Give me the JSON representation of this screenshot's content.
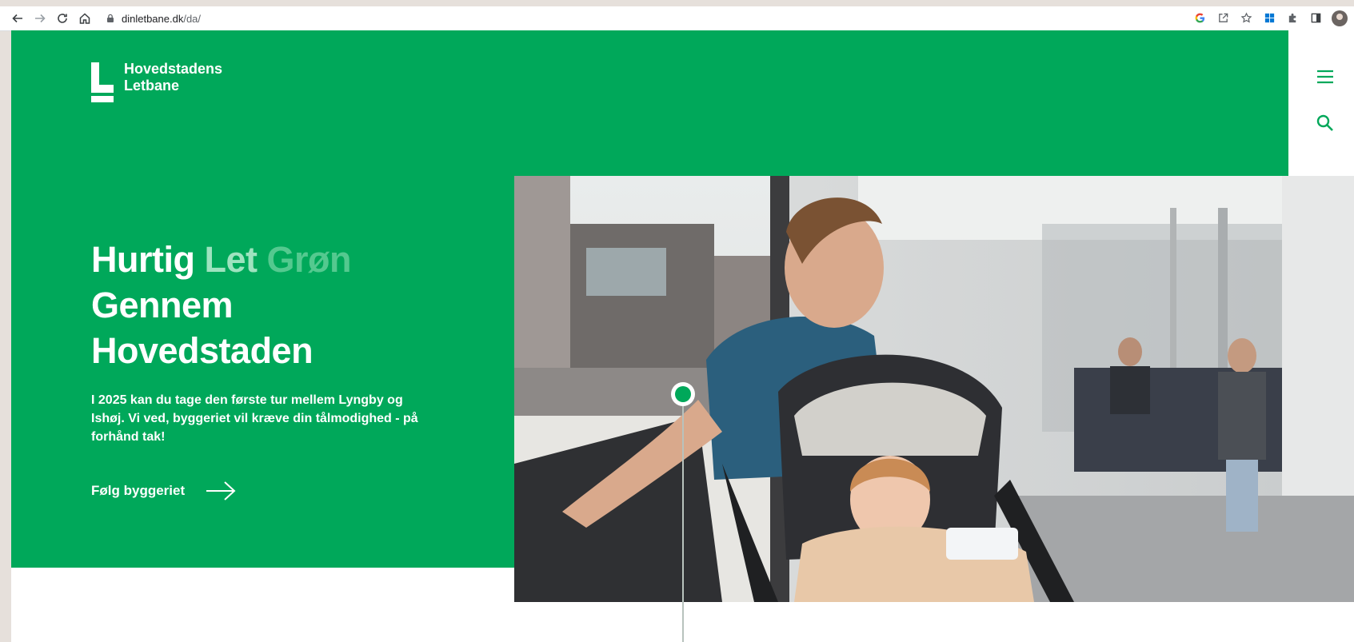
{
  "browser": {
    "url_domain": "dinletbane.dk",
    "url_path": "/da/",
    "icons": [
      "back-icon",
      "forward-icon",
      "reload-icon",
      "home-icon",
      "lock-icon",
      "google-icon",
      "share-icon",
      "bookmark-star-icon",
      "windows-extension-icon",
      "extensions-puzzle-icon",
      "side-panel-icon",
      "profile-avatar"
    ]
  },
  "site": {
    "logo_line1": "Hovedstadens",
    "logo_line2": "Letbane"
  },
  "hero": {
    "headline_word1": "Hurtig",
    "headline_word2": "Let",
    "headline_word3": "Grøn",
    "headline_line2": "Gennem",
    "headline_line3": "Hovedstaden",
    "intro": "I 2025 kan du tage den første tur mellem Lyngby og Ishøj. Vi ved, byggeriet vil kræve din tålmodighed - på forhånd tak!",
    "cta_label": "Følg byggeriet"
  },
  "colors": {
    "brand_green": "#00a85a",
    "white": "#ffffff"
  }
}
